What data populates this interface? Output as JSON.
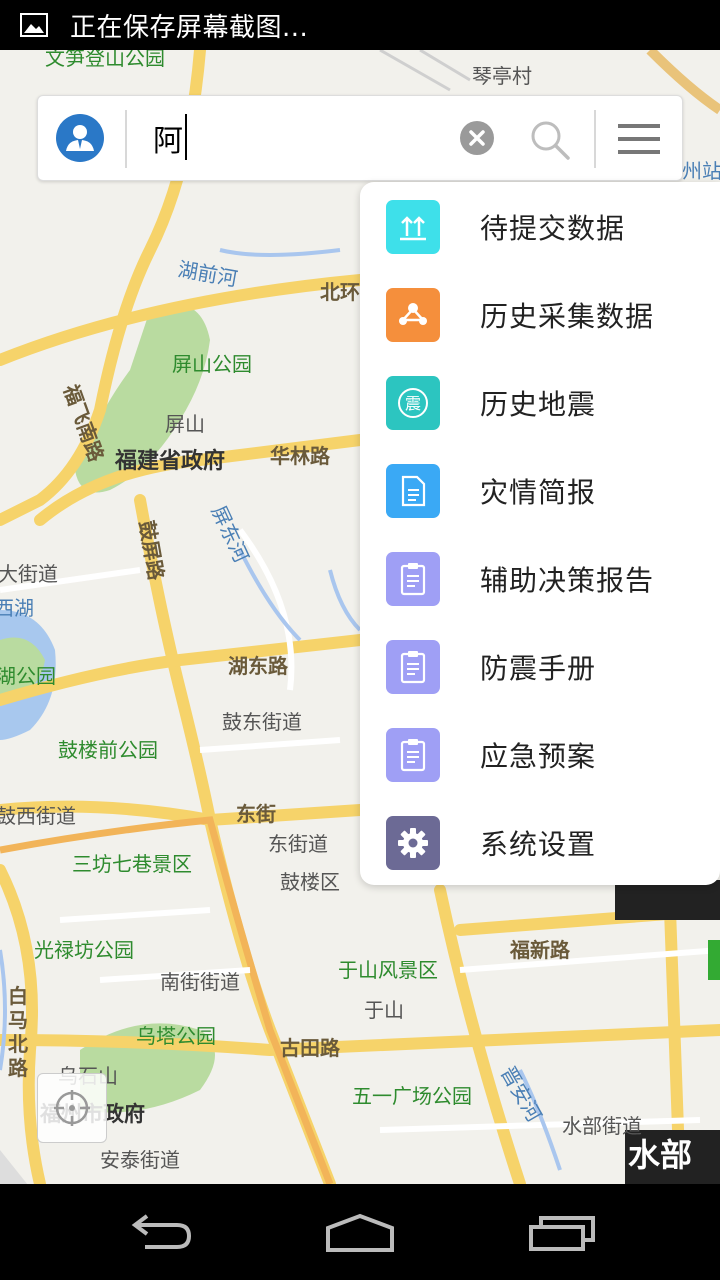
{
  "status_bar": {
    "notification_icon": "image-icon",
    "text": "正在保存屏幕截图..."
  },
  "search": {
    "value": "阿",
    "avatar_icon": "user-avatar-icon",
    "clear_icon": "clear-icon",
    "search_icon": "search-icon",
    "menu_icon": "hamburger-menu-icon"
  },
  "menu": {
    "items": [
      {
        "label": "待提交数据",
        "icon": "upload-icon",
        "color": "#3ee0ea"
      },
      {
        "label": "历史采集数据",
        "icon": "share-nodes-icon",
        "color": "#f58f3c"
      },
      {
        "label": "历史地震",
        "icon": "earthquake-icon",
        "color": "#2cc5c0"
      },
      {
        "label": "灾情简报",
        "icon": "document-icon",
        "color": "#3aa9f5"
      },
      {
        "label": "辅助决策报告",
        "icon": "clipboard-icon",
        "color": "#9f9ff5"
      },
      {
        "label": "防震手册",
        "icon": "clipboard-icon",
        "color": "#9f9ff5"
      },
      {
        "label": "应急预案",
        "icon": "clipboard-icon",
        "color": "#9f9ff5"
      },
      {
        "label": "系统设置",
        "icon": "gear-icon",
        "color": "#6c6a95"
      }
    ]
  },
  "map": {
    "labels": {
      "l1": "文笋登山公园",
      "l2": "琴亭村",
      "l3": "湖前河",
      "l4": "北环",
      "l5": "屏山公园",
      "l6": "福飞南路",
      "l7": "屏山",
      "l8": "福建省政府",
      "l9": "华林路",
      "l10": "屏东河",
      "l11": "鼓屏路",
      "l12": "大街道",
      "l13": "西湖",
      "l14": "湖公园",
      "l15": "湖东路",
      "l16": "鼓东街道",
      "l17": "鼓楼前公园",
      "l18": "鼓西街道",
      "l19": "东街",
      "l20": "东街道",
      "l21": "三坊七巷景区",
      "l22": "鼓楼区",
      "l23": "光禄坊公园",
      "l24": "南街街道",
      "l25": "于山风景区",
      "l26": "福新路",
      "l27": "于山",
      "l28": "白马北路",
      "l29": "乌塔公园",
      "l30": "古田路",
      "l31": "乌石山",
      "l32": "福州市政府",
      "l33": "五一广场公园",
      "l34": "晋安河",
      "l35": "水部街道",
      "l36": "安泰街道",
      "l37": "水部",
      "l38": "州站"
    }
  },
  "locate_icon": "locate-icon",
  "nav": {
    "back_icon": "back-icon",
    "home_icon": "home-icon",
    "recents_icon": "recents-icon"
  }
}
